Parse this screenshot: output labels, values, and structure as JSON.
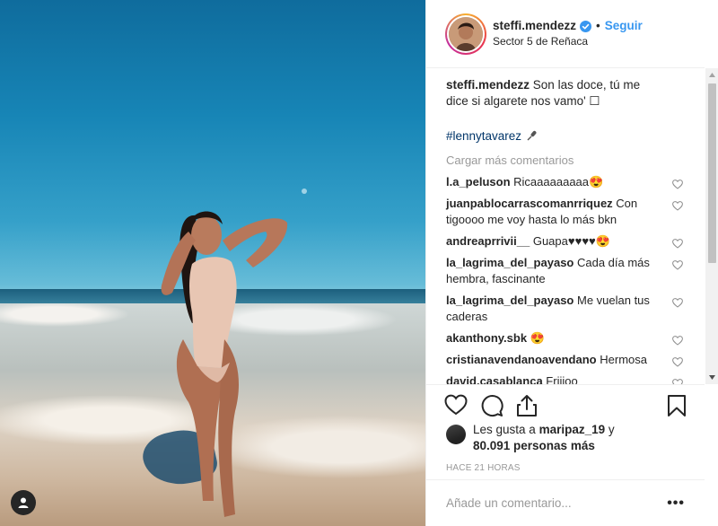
{
  "post": {
    "username": "steffi.mendezz",
    "separator": "•",
    "follow_label": "Seguir",
    "location": "Sector 5 de Reñaca"
  },
  "caption": {
    "username": "steffi.mendezz",
    "text": "Son las doce, tú me dice si algarete nos vamo' ☐",
    "hashtag": "#lennytavarez"
  },
  "load_more_label": "Cargar más comentarios",
  "comments": [
    {
      "user": "l.a_peluson",
      "text": "Ricaaaaaaaaa😍"
    },
    {
      "user": "juanpablocarrascomanrriquez",
      "text": "Con tigoooo me voy hasta lo más bkn"
    },
    {
      "user": "andreaprrivii__",
      "text": "Guapa♥♥♥♥😍"
    },
    {
      "user": "la_lagrima_del_payaso",
      "text": "Cada día más hembra, fascinante"
    },
    {
      "user": "la_lagrima_del_payaso",
      "text": "Me vuelan tus caderas"
    },
    {
      "user": "akanthony.sbk",
      "text": "😍"
    },
    {
      "user": "cristianavendanoavendano",
      "text": "Hermosa"
    },
    {
      "user": "david.casablanca",
      "text": "Friiioo"
    }
  ],
  "likes": {
    "prefix": "Les gusta a",
    "user": "maripaz_19",
    "connector": "y",
    "count": "80.091 personas más"
  },
  "timestamp": "HACE 21 HORAS",
  "add_comment_placeholder": "Añade un comentario...",
  "more_label": "•••",
  "colors": {
    "accent": "#3897f0",
    "hashtag": "#003569",
    "muted": "#999999",
    "text": "#262626"
  }
}
